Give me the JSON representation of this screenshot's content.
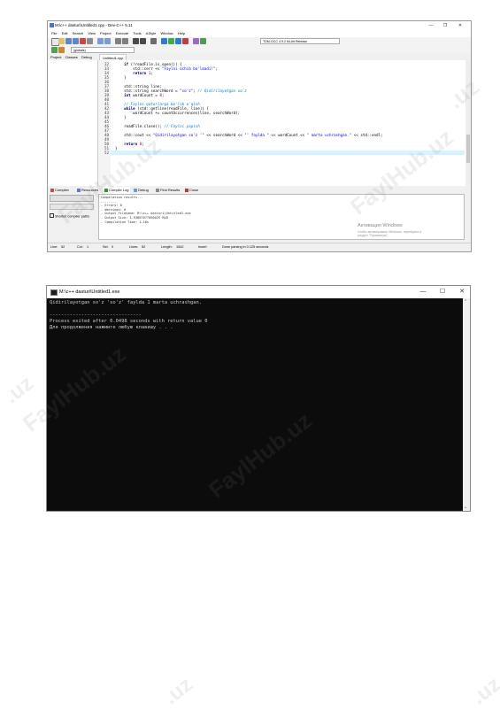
{
  "ide": {
    "title": "M:\\c++ dasturi\\Untitled1.cpp - Dev-C++ 5.11",
    "menu": [
      "File",
      "Edit",
      "Search",
      "View",
      "Project",
      "Execute",
      "Tools",
      "AStyle",
      "Window",
      "Help"
    ],
    "compiler_select": "TDM-GCC 4.9.2 64-bit Release",
    "globals_select": "(globals)",
    "left_tabs": [
      "Project",
      "Classes",
      "Debug"
    ],
    "editor_tab": "Untitled1.cpp",
    "code_lines": [
      {
        "n": "32",
        "t": "    if (!readFile.is_open()) {"
      },
      {
        "n": "33",
        "t": "        std::cerr << \"Faylni ochib bo'lmadi!\";"
      },
      {
        "n": "34",
        "t": "        return 1;"
      },
      {
        "n": "35",
        "t": "    }"
      },
      {
        "n": "36",
        "t": ""
      },
      {
        "n": "37",
        "t": "    std::string line;"
      },
      {
        "n": "38",
        "t": "    std::string searchWord = \"so'z\"; // Qidirilayotgan so'z"
      },
      {
        "n": "39",
        "t": "    int wordCount = 0;"
      },
      {
        "n": "40",
        "t": ""
      },
      {
        "n": "41",
        "t": "    // Faylni qatorlarga bo'lib o'qish"
      },
      {
        "n": "42",
        "t": "    while (std::getline(readFile, line)) {"
      },
      {
        "n": "43",
        "t": "        wordCount += countOccurrences(line, searchWord);"
      },
      {
        "n": "44",
        "t": "    }"
      },
      {
        "n": "45",
        "t": ""
      },
      {
        "n": "46",
        "t": "    readFile.close(); // Faylni yopish"
      },
      {
        "n": "47",
        "t": ""
      },
      {
        "n": "48",
        "t": "    std::cout << \"Qidirilayotgan so'z '\" << searchWord << \"' faylda \" << wordCount << \" marta uchrashgan.\" << std::endl;"
      },
      {
        "n": "49",
        "t": ""
      },
      {
        "n": "50",
        "t": "    return 0;"
      },
      {
        "n": "51",
        "t": "}"
      },
      {
        "n": "52",
        "t": ""
      }
    ],
    "bottom_tabs": [
      "Compiler",
      "Resources",
      "Compile Log",
      "Debug",
      "Find Results",
      "Close"
    ],
    "abort_label": "Abort Compilation",
    "shorten_label": "Shorten compiler paths",
    "log_lines": [
      "Compilation results...",
      "--------",
      "- Errors: 0",
      "- Warnings: 0",
      "- Output Filename: M:\\c++ dasturi\\Untitled1.exe",
      "- Output Size: 1.93807077050029 MiB",
      "- Compilation Time: 1.16s"
    ],
    "activate_title": "Активация Windows",
    "activate_sub": "Чтобы активировать Windows, перейдите в раздел \"Параметры\".",
    "status": {
      "line": "Line:",
      "line_val": "52",
      "col": "Col:",
      "col_val": "1",
      "sel": "Sel:",
      "sel_val": "0",
      "lines": "Lines:",
      "lines_val": "52",
      "length": "Length:",
      "length_val": "1542",
      "mode": "Insert",
      "msg": "Done parsing in 0.125 seconds"
    }
  },
  "console": {
    "title": "M:\\c++ dasturi\\Untitled1.exe",
    "lines": [
      "Qidirilayotgan so'z 'so'z' faylda 1 marta uchrashgan.",
      "",
      "--------------------------------",
      "Process exited after 0.0498 seconds with return value 0",
      "Для продолжения нажмите любую клавишу . . ."
    ]
  },
  "watermarks": [
    "FaylHub.uz",
    "FaylHub.uz",
    "FaylHub.uz",
    "FaylHub.uz",
    ".uz",
    ".uz",
    ".uz",
    ".uz"
  ],
  "colors": {
    "keyword": "#000080",
    "string": "#0000ff",
    "comment": "#0078d7",
    "number": "#8b008b",
    "highlight": "#d8f2ff",
    "console_bg": "#0c0c0c",
    "console_fg": "#cccccc"
  }
}
